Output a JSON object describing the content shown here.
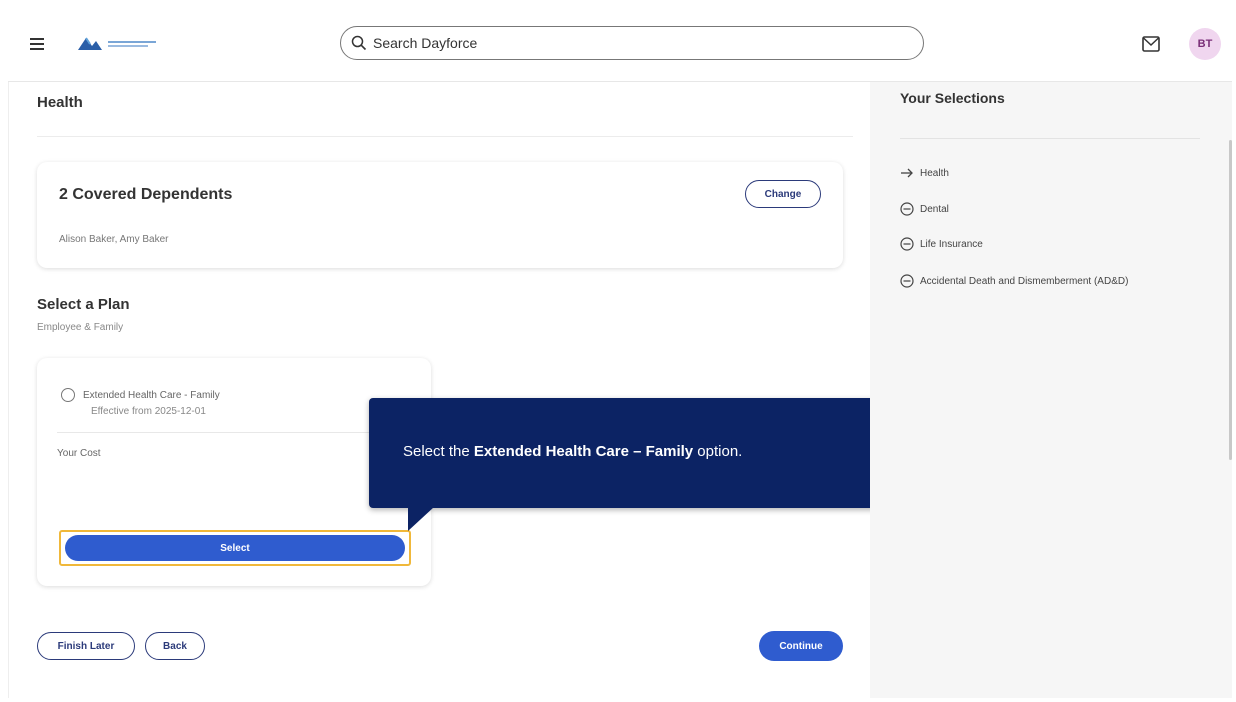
{
  "header": {
    "search_placeholder": "Search Dayforce",
    "avatar_initials": "BT"
  },
  "main": {
    "page_title": "Health",
    "dependents": {
      "title": "2 Covered Dependents",
      "names": "Alison Baker, Amy Baker",
      "change_label": "Change"
    },
    "plan_section": {
      "title": "Select a Plan",
      "subtitle": "Employee & Family"
    },
    "plan": {
      "name": "Extended Health Care - Family",
      "effective": "Effective from 2025-12-01",
      "cost_label": "Your Cost",
      "select_label": "Select"
    },
    "footer": {
      "finish_later_label": "Finish Later",
      "back_label": "Back",
      "continue_label": "Continue"
    }
  },
  "tooltip": {
    "prefix": "Select the ",
    "bold": "Extended Health Care – Family",
    "suffix": " option."
  },
  "selections": {
    "title": "Your Selections",
    "items": [
      {
        "label": "Health",
        "icon": "arrow-right-icon"
      },
      {
        "label": "Dental",
        "icon": "circle-minus-icon"
      },
      {
        "label": "Life Insurance",
        "icon": "circle-minus-icon"
      },
      {
        "label": "Accidental Death and Dismemberment (AD&D)",
        "icon": "circle-minus-icon"
      }
    ]
  },
  "colors": {
    "primary_button": "#2f5ccf",
    "tooltip_bg": "#0c2364",
    "highlight": "#f0b83a",
    "avatar_bg": "#f0d6ef"
  }
}
